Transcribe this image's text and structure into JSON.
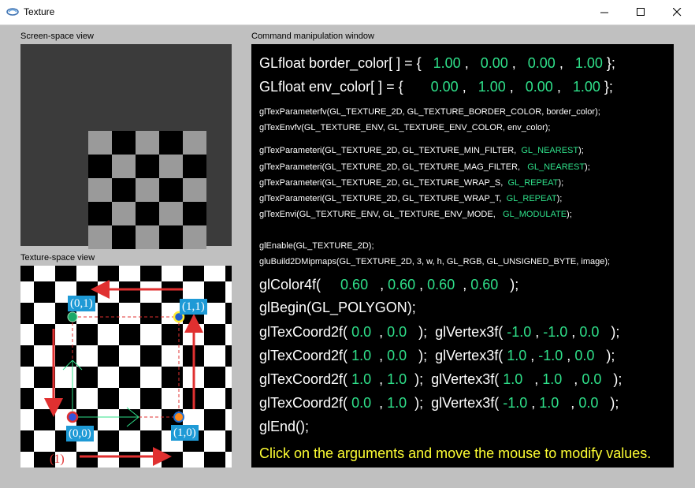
{
  "window": {
    "title": "Texture"
  },
  "labels": {
    "screen_view": "Screen-space view",
    "texture_view": "Texture-space view",
    "command_window": "Command manipulation window"
  },
  "colors": {
    "accent_green": "#2fe08a",
    "hint_yellow": "#ffff33",
    "label_blue": "#1e9ad6",
    "arrow_red": "#e03030"
  },
  "texture_space": {
    "corner_labels": {
      "tl": "(0,1)",
      "tr": "(1,1)",
      "bl": "(0,0)",
      "br": "(1,0)"
    },
    "step_label": "(1)"
  },
  "code": {
    "border_color": {
      "prefix": "GLfloat border_color[ ] = {",
      "values": [
        "1.00",
        "0.00",
        "0.00",
        "1.00"
      ],
      "suffix": "};"
    },
    "env_color": {
      "prefix": "GLfloat env_color[ ] = {",
      "values": [
        "0.00",
        "1.00",
        "0.00",
        "1.00"
      ],
      "suffix": "};"
    },
    "tex_param_fv": "glTexParameterfv(GL_TEXTURE_2D, GL_TEXTURE_BORDER_COLOR, border_color);",
    "tex_env_fv": "glTexEnvfv(GL_TEXTURE_ENV, GL_TEXTURE_ENV_COLOR, env_color);",
    "params": [
      {
        "text": "glTexParameteri(GL_TEXTURE_2D, GL_TEXTURE_MIN_FILTER, ",
        "value": "GL_NEAREST",
        "close": ");"
      },
      {
        "text": "glTexParameteri(GL_TEXTURE_2D, GL_TEXTURE_MAG_FILTER, ",
        "value": "GL_NEAREST",
        "close": ");"
      },
      {
        "text": "glTexParameteri(GL_TEXTURE_2D, GL_TEXTURE_WRAP_S, ",
        "value": "GL_REPEAT",
        "close": ");"
      },
      {
        "text": "glTexParameteri(GL_TEXTURE_2D, GL_TEXTURE_WRAP_T, ",
        "value": "GL_REPEAT",
        "close": ");"
      },
      {
        "text": "glTexEnvi(GL_TEXTURE_ENV, GL_TEXTURE_ENV_MODE, ",
        "value": "GL_MODULATE",
        "close": ");"
      }
    ],
    "enable": "glEnable(GL_TEXTURE_2D);",
    "mipmaps": "gluBuild2DMipmaps(GL_TEXTURE_2D, 3, w, h, GL_RGB, GL_UNSIGNED_BYTE, image);",
    "color4f": {
      "prefix": "glColor4f(",
      "values": [
        "0.60",
        "0.60",
        "0.60",
        "0.60"
      ],
      "suffix": ");"
    },
    "begin": "glBegin(GL_POLYGON);",
    "vertices": [
      {
        "tex": [
          "0.0",
          "0.0"
        ],
        "pos": [
          "-1.0",
          "-1.0",
          "0.0"
        ]
      },
      {
        "tex": [
          "1.0",
          "0.0"
        ],
        "pos": [
          "1.0",
          "-1.0",
          "0.0"
        ]
      },
      {
        "tex": [
          "1.0",
          "1.0"
        ],
        "pos": [
          "1.0",
          "1.0",
          "0.0"
        ]
      },
      {
        "tex": [
          "0.0",
          "1.0"
        ],
        "pos": [
          "-1.0",
          "1.0",
          "0.0"
        ]
      }
    ],
    "texcoord_fn": "glTexCoord2f(",
    "vertex_fn": "glVertex3f(",
    "end": "glEnd();",
    "hint": "Click on the arguments and move the mouse to modify values."
  }
}
